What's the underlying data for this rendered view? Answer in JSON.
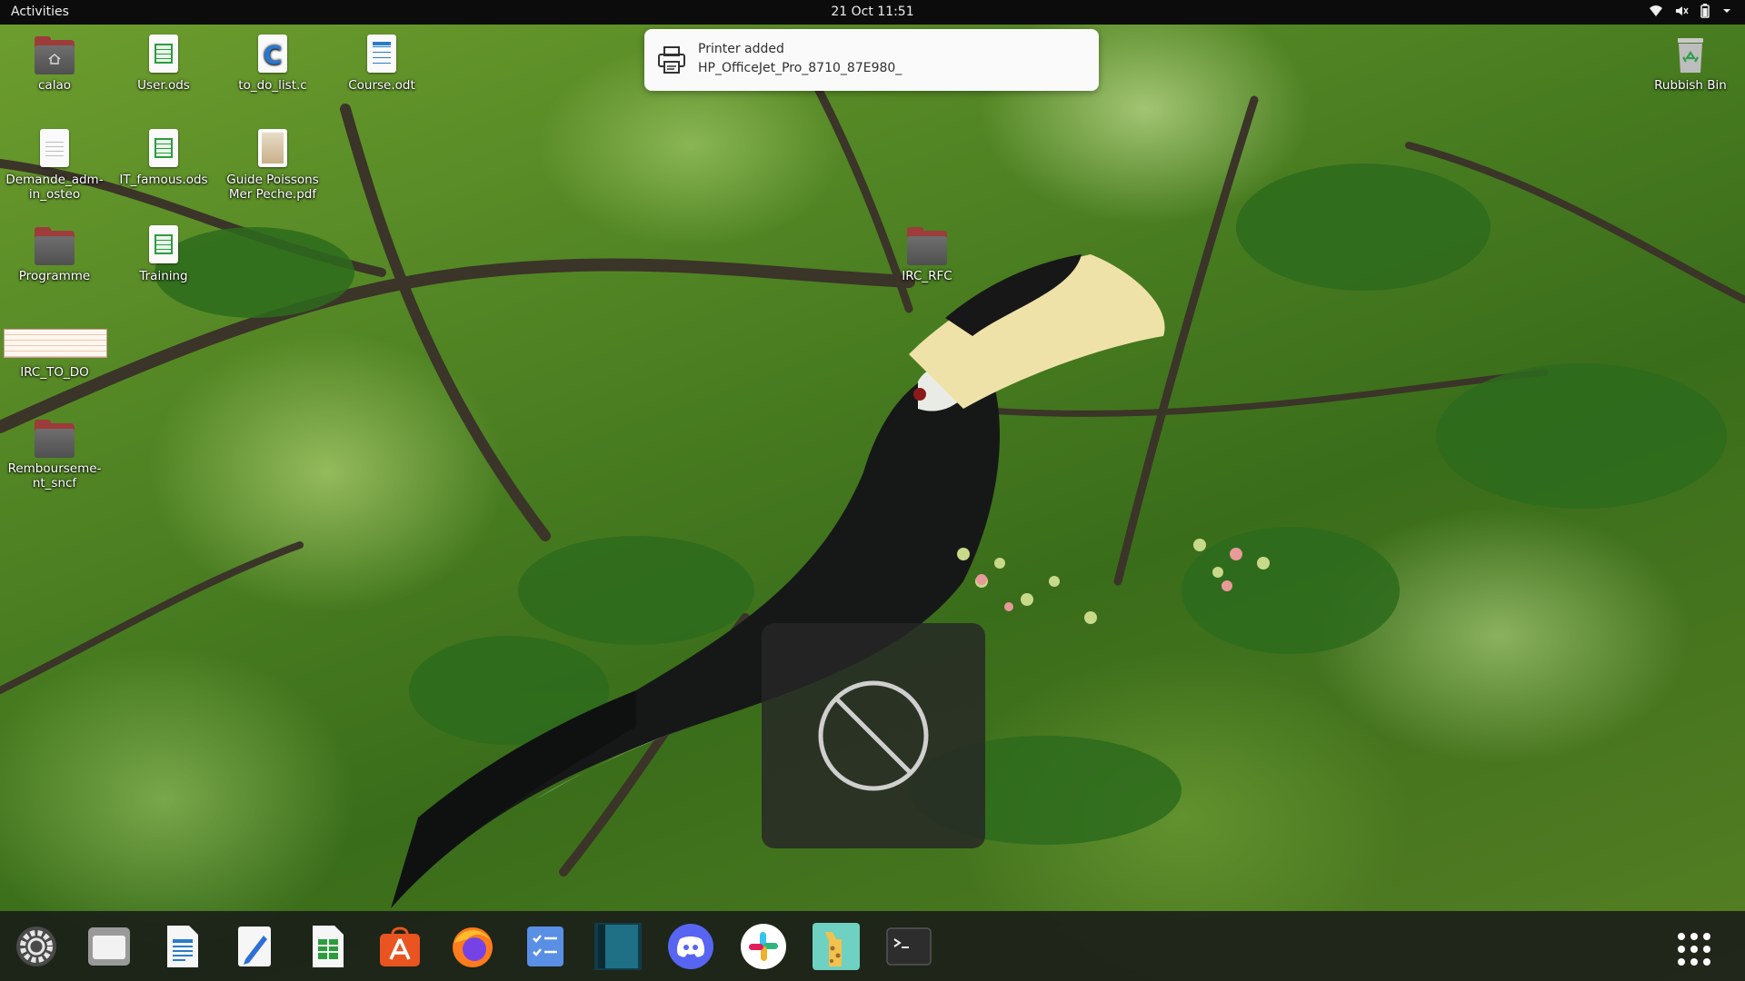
{
  "topbar": {
    "activities": "Activities",
    "clock": "21 Oct  11:51",
    "status_icons": [
      "wifi-icon",
      "volume-muted-icon",
      "battery-icon",
      "chevron-down-icon"
    ]
  },
  "desktop": {
    "icons": [
      {
        "label": "calao",
        "kind": "home-folder"
      },
      {
        "label": "User.ods",
        "kind": "spreadsheet"
      },
      {
        "label": "to_do_list.c",
        "kind": "c-source"
      },
      {
        "label": "Course.odt",
        "kind": "text-document"
      },
      {
        "label": "Demande_adm-in_osteo",
        "kind": "document"
      },
      {
        "label": "IT_famous.ods",
        "kind": "spreadsheet"
      },
      {
        "label": "Guide Poissons Mer Peche.pdf",
        "kind": "pdf"
      },
      {
        "label": "Programme",
        "kind": "folder"
      },
      {
        "label": "Training",
        "kind": "spreadsheet"
      },
      {
        "label": "IRC_TO_DO",
        "kind": "image"
      },
      {
        "label": "Rembourseme-nt_sncf",
        "kind": "folder"
      },
      {
        "label": "IRC_RFC",
        "kind": "folder"
      },
      {
        "label": "Rubbish Bin",
        "kind": "trash"
      }
    ]
  },
  "notification": {
    "title": "Printer added",
    "body": "HP_OfficeJet_Pro_8710_87E980_",
    "icon": "printer-icon"
  },
  "osd": {
    "icon": "no-entry-icon"
  },
  "dock": {
    "items": [
      "settings",
      "files",
      "libreoffice-writer",
      "text-editor",
      "libreoffice-calc",
      "ubuntu-software",
      "firefox",
      "tasks",
      "vscodium",
      "discord",
      "slack",
      "giraffe-app",
      "terminal"
    ],
    "show_apps": "show-applications-icon"
  },
  "colors": {
    "topbar": "#0c0c0c",
    "dock": "#181818",
    "folder_tab": "#9e3b3b",
    "notification_bg": "#fafafa"
  }
}
